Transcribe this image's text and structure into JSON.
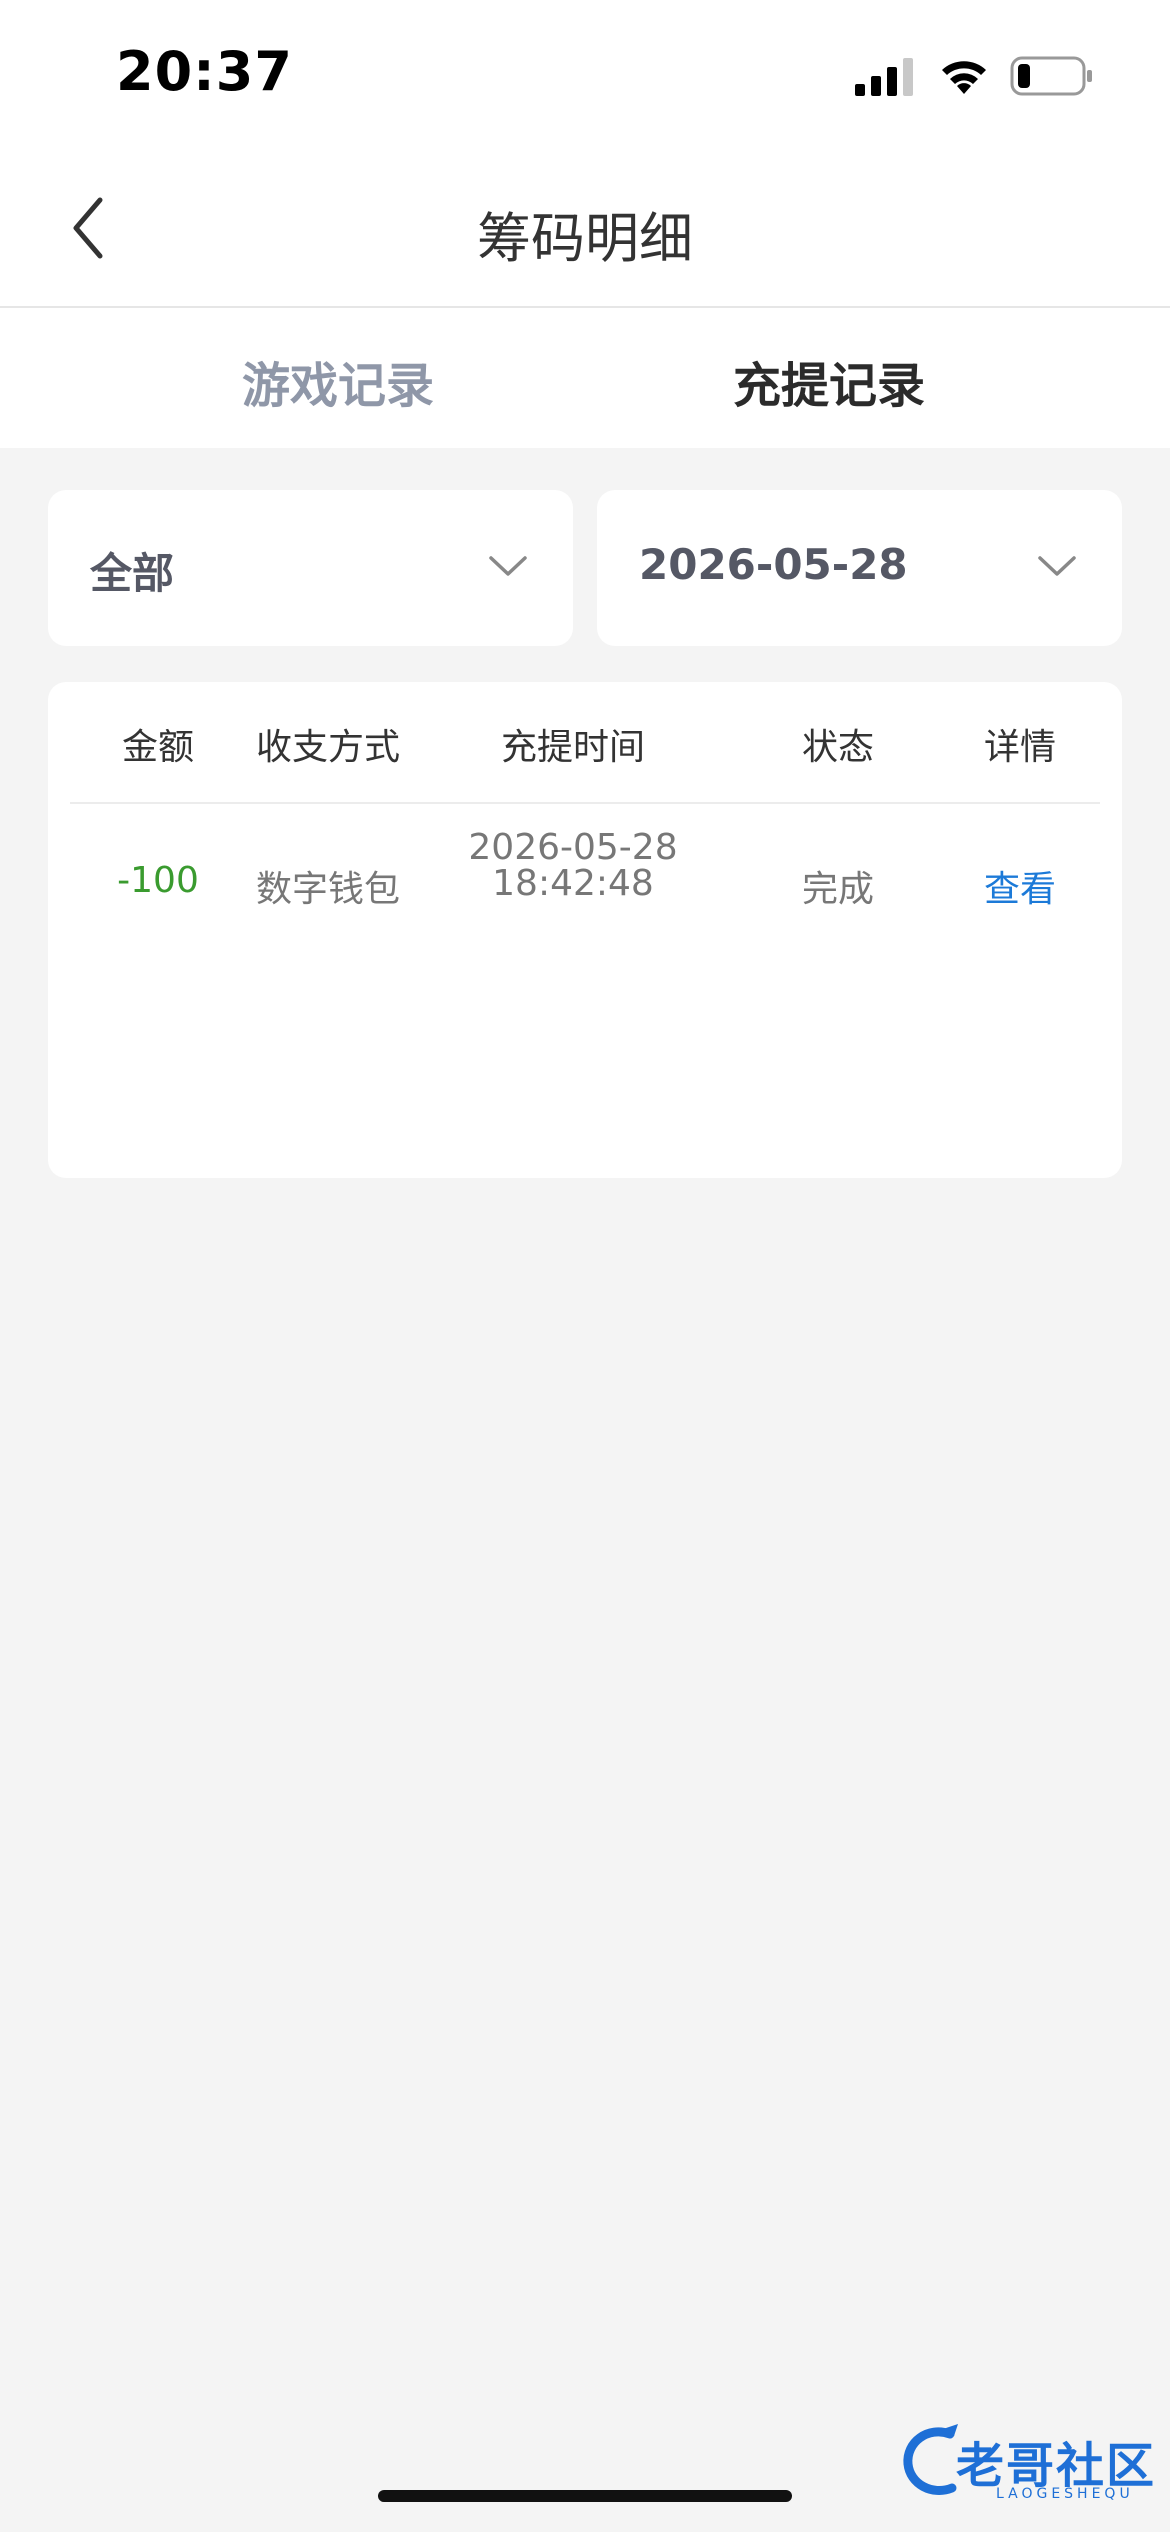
{
  "status_bar": {
    "time": "20:37",
    "icons": [
      "cellular-signal-icon",
      "wifi-icon",
      "battery-icon"
    ]
  },
  "nav": {
    "back_icon": "chevron-left-icon",
    "title": "筹码明细"
  },
  "tabs": [
    {
      "label": "游戏记录",
      "active": false
    },
    {
      "label": "充提记录",
      "active": true
    }
  ],
  "filters": {
    "type": {
      "value": "全部",
      "icon": "chevron-down-icon"
    },
    "date": {
      "value": "2026-05-28",
      "icon": "chevron-down-icon"
    }
  },
  "table": {
    "headers": [
      "金额",
      "收支方式",
      "充提时间",
      "状态",
      "详情"
    ],
    "rows": [
      {
        "amount": "-100",
        "method": "数字钱包",
        "date": "2026-05-28",
        "time": "18:42:48",
        "status": "完成",
        "detail": "查看"
      }
    ]
  },
  "watermark": {
    "text": "老哥社区",
    "subtext": "LAOGESHEQU"
  },
  "colors": {
    "accent": "#1c7ad8",
    "negative_amount": "#3a9b2f",
    "inactive_tab": "#8f97a8",
    "background": "#f4f4f4"
  }
}
